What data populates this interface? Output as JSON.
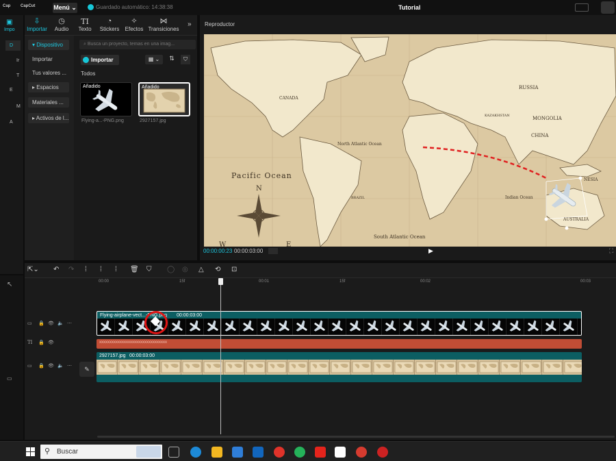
{
  "titlebar": {
    "logo_text": "Cap",
    "logo_text2": "CapCut",
    "menu_label": "Menú",
    "autosave_text": "Guardado automático: 14:38:38",
    "window_title": "Tutorial"
  },
  "left_strip": {
    "items": [
      "Impo",
      "D",
      "Ir",
      "T",
      "E",
      "M",
      "A"
    ]
  },
  "media": {
    "tabs": [
      {
        "label": "Importar",
        "icon": "import-icon"
      },
      {
        "label": "Audio",
        "icon": "audio-icon"
      },
      {
        "label": "Texto",
        "icon": "text-icon"
      },
      {
        "label": "Stickers",
        "icon": "sticker-icon"
      },
      {
        "label": "Efectos",
        "icon": "effects-icon"
      },
      {
        "label": "Transiciones",
        "icon": "transition-icon"
      }
    ],
    "side_items": [
      "Dispositivo",
      "Importar",
      "Tus valores ...",
      "Espacios",
      "Materiales ...",
      "Activos de l..."
    ],
    "search_placeholder": "Busca un proyecto, temas en una imag...",
    "import_label": "Importar",
    "all_label": "Todos",
    "items": [
      {
        "badge": "Añadido",
        "caption": "Flying-a...-PNG.png"
      },
      {
        "badge": "Añadido",
        "caption": "2927157.jpg"
      }
    ]
  },
  "player": {
    "title": "Reproductor",
    "time_current": "00:00:00:23",
    "time_total": "00:00:03:00",
    "map_labels": {
      "pacific": "Pacific Ocean",
      "north_atlantic": "North Atlantic Ocean",
      "south_atlantic": "South Atlantic Ocean",
      "indian": "Indian Ocean",
      "russia": "RUSSIA",
      "mongolia": "MONGOLIA",
      "china": "CHINA",
      "canada": "CANADA",
      "brazil": "BRAZIL",
      "australia": "AUSTRALIA",
      "kazakhstan": "KAZAKHSTAN",
      "indonesia": "NESIA",
      "compass_n": "N",
      "compass_w": "W",
      "compass_e": "E"
    }
  },
  "timeline": {
    "ruler": [
      "00:00",
      "15f",
      "00:01",
      "15f",
      "00:02",
      "00:03"
    ],
    "plane_clip": {
      "label": "Flying-airplane-vect...-PNG.png",
      "duration": "00:00:03:00"
    },
    "text_clip": {
      "label": "xxxxxxxxxxxxxxxxxxxxxxxxxxxxxxxxx"
    },
    "map_clip": {
      "label": "2927157.jpg",
      "duration": "00:00:03:00"
    }
  },
  "taskbar": {
    "search_label": "Buscar"
  },
  "colors": {
    "accent": "#1ec8e0",
    "clip_teal": "#0c5e62",
    "text_clip": "#c14d35",
    "keyframe_highlight": "#e01515"
  }
}
